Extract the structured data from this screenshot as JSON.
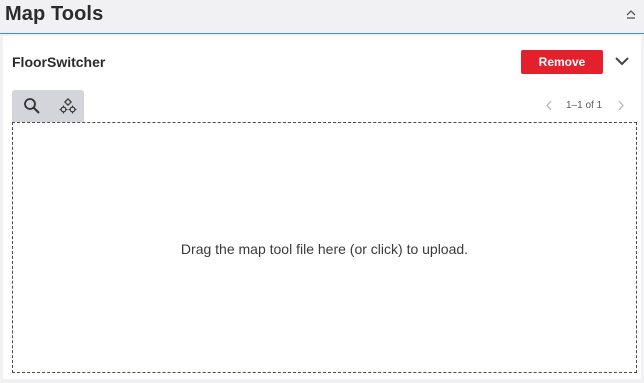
{
  "section": {
    "title": "Map Tools"
  },
  "panel": {
    "title": "FloorSwitcher",
    "remove_label": "Remove"
  },
  "tools": {
    "tabs": [
      "search-icon",
      "settings-icon"
    ]
  },
  "pagination": {
    "info": "1–1 of 1"
  },
  "dropzone": {
    "text": "Drag the map tool file here (or click) to upload."
  },
  "colors": {
    "accent": "#3b8ed6",
    "danger": "#e3202b",
    "tab_bg": "#d4d5db"
  }
}
